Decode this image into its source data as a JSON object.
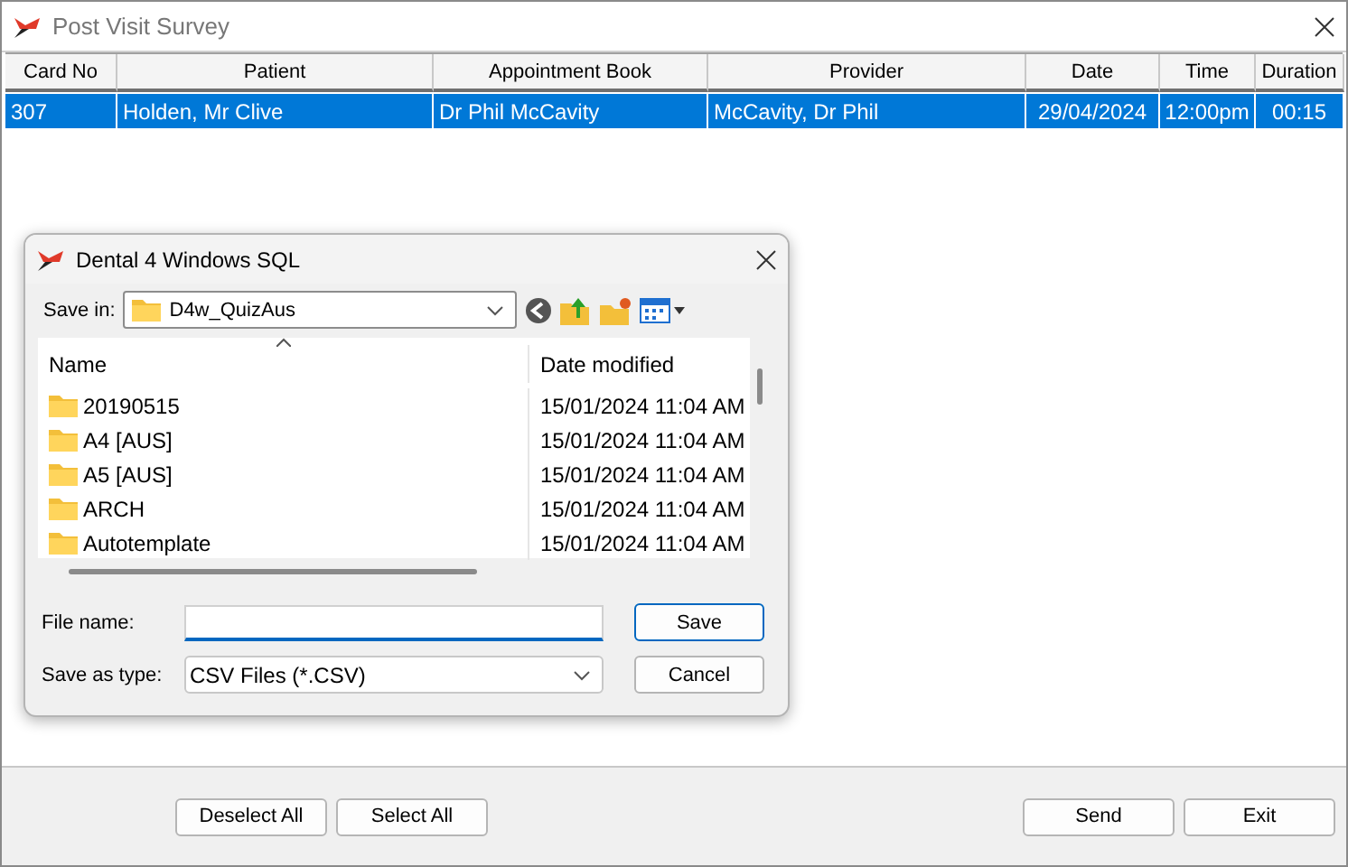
{
  "window": {
    "title": "Post Visit Survey"
  },
  "table": {
    "columns": [
      "Card No",
      "Patient",
      "Appointment Book",
      "Provider",
      "Date",
      "Time",
      "Duration"
    ],
    "rows": [
      {
        "selected": true,
        "cells": [
          "307",
          "Holden, Mr Clive",
          "Dr Phil McCavity",
          "McCavity, Dr Phil",
          "29/04/2024",
          "12:00pm",
          "00:15"
        ]
      }
    ]
  },
  "buttons_left": [
    "Deselect All",
    "Select All"
  ],
  "buttons_right": [
    "Send",
    "Exit"
  ],
  "dialog": {
    "title": "Dental 4 Windows SQL",
    "save_in_label": "Save in:",
    "save_in_value": "D4w_QuizAus",
    "list_columns": [
      "Name",
      "Date modified"
    ],
    "items": [
      {
        "name": "20190515",
        "date": "15/01/2024 11:04 AM"
      },
      {
        "name": "A4 [AUS]",
        "date": "15/01/2024 11:04 AM"
      },
      {
        "name": "A5 [AUS]",
        "date": "15/01/2024 11:04 AM"
      },
      {
        "name": "ARCH",
        "date": "15/01/2024 11:04 AM"
      },
      {
        "name": "Autotemplate",
        "date": "15/01/2024 11:04 AM"
      }
    ],
    "file_name_label": "File name:",
    "type_label": "Save as type:",
    "type_value": "CSV Files (*.CSV)",
    "save_button": "Save",
    "cancel_button": "Cancel"
  }
}
